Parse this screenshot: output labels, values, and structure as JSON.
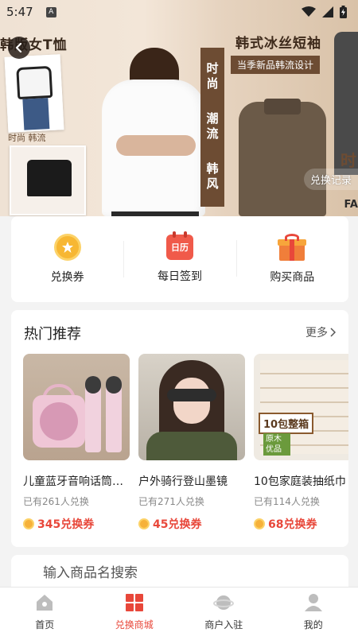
{
  "status_bar": {
    "time": "5:47",
    "a_badge": "A"
  },
  "banner": {
    "left_title": "韩版女T恤",
    "photo_caption": "时尚 韩流",
    "vertical_words": [
      "时尚",
      "潮流",
      "韩风"
    ],
    "right_title": "韩式冰丝短袖",
    "right_subtitle": "当季新品韩流设计",
    "edge_text": "时",
    "edge_text2": "FA",
    "redeem_record": "兑换记录"
  },
  "quick_actions": [
    {
      "label": "兑换券",
      "icon": "coin-icon"
    },
    {
      "label": "每日签到",
      "icon": "calendar-icon",
      "icon_text": "日历"
    },
    {
      "label": "购买商品",
      "icon": "gift-icon"
    }
  ],
  "hot": {
    "title": "热门推荐",
    "more": "更多",
    "products": [
      {
        "name": "儿童蓝牙音响话筒套装",
        "count": "已有261人兑换",
        "price": "345兑换券"
      },
      {
        "name": "户外骑行登山墨镜",
        "count": "已有271人兑换",
        "price": "45兑换券"
      },
      {
        "name": "10包家庭装抽纸巾",
        "count": "已有114人兑换",
        "price": "68兑换券"
      }
    ],
    "product3_label": "10包整箱",
    "product3_sub": "原木优品"
  },
  "search": {
    "placeholder": "输入商品名搜索"
  },
  "bottom_nav": [
    {
      "label": "首页",
      "icon": "home-icon",
      "active": false
    },
    {
      "label": "兑换商城",
      "icon": "mall-icon",
      "active": true
    },
    {
      "label": "商户入驻",
      "icon": "merchant-icon",
      "active": false
    },
    {
      "label": "我的",
      "icon": "profile-icon",
      "active": false
    }
  ],
  "colors": {
    "accent": "#e8473a",
    "coin": "#f6b13a",
    "brown": "#6d4c33"
  }
}
